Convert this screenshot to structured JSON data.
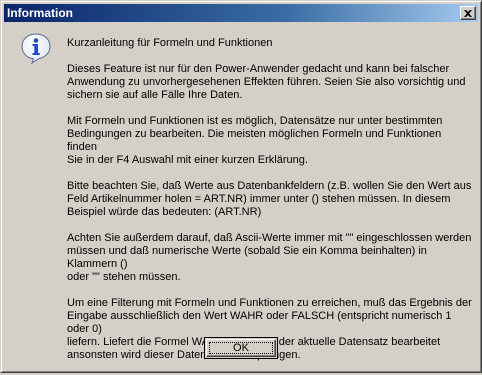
{
  "window": {
    "title": "Information",
    "close_icon": "close-icon"
  },
  "icon": {
    "name": "info-icon",
    "glyph": "i",
    "color": "#1f4fbf"
  },
  "message": {
    "heading": "Kurzanleitung für Formeln und Funktionen",
    "paragraphs": [
      "Dieses Feature ist nur für den Power-Anwender gedacht und kann bei falscher\nAnwendung zu unvorhergesehenen Effekten führen. Seien Sie also vorsichtig und\nsichern sie auf alle Fälle Ihre Daten.",
      "Mit Formeln und Funktionen ist es möglich, Datensätze nur unter bestimmten\nBedingungen zu bearbeiten. Die meisten möglichen Formeln und Funktionen finden\nSie in der F4 Auswahl mit einer kurzen Erklärung.",
      "Bitte beachten Sie, daß Werte aus Datenbankfeldern (z.B. wollen Sie den Wert aus\nFeld Artikelnummer holen = ART.NR) immer unter () stehen müssen. In diesem\nBeispiel würde das bedeuten: (ART.NR)",
      "Achten Sie außerdem darauf, daß Ascii-Werte immer mit \"\" eingeschlossen werden\nmüssen und daß numerische Werte (sobald Sie ein Komma beinhalten) in Klammern ()\noder \"\" stehen müssen.",
      "Um eine Filterung mit Formeln und Funktionen zu erreichen, muß das Ergebnis der\nEingabe ausschließlich den Wert WAHR oder FALSCH (entspricht numerisch 1 oder 0)\nliefern. Liefert die Formel WAHR dann wird der aktuelle Datensatz bearbeitet\nansonsten wird dieser Datensatz übersprungen."
    ]
  },
  "buttons": {
    "ok_label": "OK"
  },
  "colors": {
    "dialog_bg": "#d4d0c8",
    "titlebar_start": "#0a246a",
    "titlebar_end": "#a6caf0"
  }
}
